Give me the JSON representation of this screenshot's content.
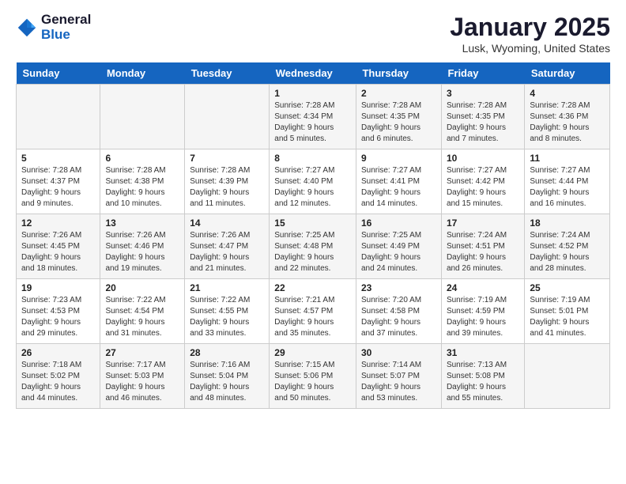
{
  "logo": {
    "general": "General",
    "blue": "Blue"
  },
  "title": "January 2025",
  "location": "Lusk, Wyoming, United States",
  "headers": [
    "Sunday",
    "Monday",
    "Tuesday",
    "Wednesday",
    "Thursday",
    "Friday",
    "Saturday"
  ],
  "weeks": [
    [
      {
        "day": "",
        "content": ""
      },
      {
        "day": "",
        "content": ""
      },
      {
        "day": "",
        "content": ""
      },
      {
        "day": "1",
        "content": "Sunrise: 7:28 AM\nSunset: 4:34 PM\nDaylight: 9 hours\nand 5 minutes."
      },
      {
        "day": "2",
        "content": "Sunrise: 7:28 AM\nSunset: 4:35 PM\nDaylight: 9 hours\nand 6 minutes."
      },
      {
        "day": "3",
        "content": "Sunrise: 7:28 AM\nSunset: 4:35 PM\nDaylight: 9 hours\nand 7 minutes."
      },
      {
        "day": "4",
        "content": "Sunrise: 7:28 AM\nSunset: 4:36 PM\nDaylight: 9 hours\nand 8 minutes."
      }
    ],
    [
      {
        "day": "5",
        "content": "Sunrise: 7:28 AM\nSunset: 4:37 PM\nDaylight: 9 hours\nand 9 minutes."
      },
      {
        "day": "6",
        "content": "Sunrise: 7:28 AM\nSunset: 4:38 PM\nDaylight: 9 hours\nand 10 minutes."
      },
      {
        "day": "7",
        "content": "Sunrise: 7:28 AM\nSunset: 4:39 PM\nDaylight: 9 hours\nand 11 minutes."
      },
      {
        "day": "8",
        "content": "Sunrise: 7:27 AM\nSunset: 4:40 PM\nDaylight: 9 hours\nand 12 minutes."
      },
      {
        "day": "9",
        "content": "Sunrise: 7:27 AM\nSunset: 4:41 PM\nDaylight: 9 hours\nand 14 minutes."
      },
      {
        "day": "10",
        "content": "Sunrise: 7:27 AM\nSunset: 4:42 PM\nDaylight: 9 hours\nand 15 minutes."
      },
      {
        "day": "11",
        "content": "Sunrise: 7:27 AM\nSunset: 4:44 PM\nDaylight: 9 hours\nand 16 minutes."
      }
    ],
    [
      {
        "day": "12",
        "content": "Sunrise: 7:26 AM\nSunset: 4:45 PM\nDaylight: 9 hours\nand 18 minutes."
      },
      {
        "day": "13",
        "content": "Sunrise: 7:26 AM\nSunset: 4:46 PM\nDaylight: 9 hours\nand 19 minutes."
      },
      {
        "day": "14",
        "content": "Sunrise: 7:26 AM\nSunset: 4:47 PM\nDaylight: 9 hours\nand 21 minutes."
      },
      {
        "day": "15",
        "content": "Sunrise: 7:25 AM\nSunset: 4:48 PM\nDaylight: 9 hours\nand 22 minutes."
      },
      {
        "day": "16",
        "content": "Sunrise: 7:25 AM\nSunset: 4:49 PM\nDaylight: 9 hours\nand 24 minutes."
      },
      {
        "day": "17",
        "content": "Sunrise: 7:24 AM\nSunset: 4:51 PM\nDaylight: 9 hours\nand 26 minutes."
      },
      {
        "day": "18",
        "content": "Sunrise: 7:24 AM\nSunset: 4:52 PM\nDaylight: 9 hours\nand 28 minutes."
      }
    ],
    [
      {
        "day": "19",
        "content": "Sunrise: 7:23 AM\nSunset: 4:53 PM\nDaylight: 9 hours\nand 29 minutes."
      },
      {
        "day": "20",
        "content": "Sunrise: 7:22 AM\nSunset: 4:54 PM\nDaylight: 9 hours\nand 31 minutes."
      },
      {
        "day": "21",
        "content": "Sunrise: 7:22 AM\nSunset: 4:55 PM\nDaylight: 9 hours\nand 33 minutes."
      },
      {
        "day": "22",
        "content": "Sunrise: 7:21 AM\nSunset: 4:57 PM\nDaylight: 9 hours\nand 35 minutes."
      },
      {
        "day": "23",
        "content": "Sunrise: 7:20 AM\nSunset: 4:58 PM\nDaylight: 9 hours\nand 37 minutes."
      },
      {
        "day": "24",
        "content": "Sunrise: 7:19 AM\nSunset: 4:59 PM\nDaylight: 9 hours\nand 39 minutes."
      },
      {
        "day": "25",
        "content": "Sunrise: 7:19 AM\nSunset: 5:01 PM\nDaylight: 9 hours\nand 41 minutes."
      }
    ],
    [
      {
        "day": "26",
        "content": "Sunrise: 7:18 AM\nSunset: 5:02 PM\nDaylight: 9 hours\nand 44 minutes."
      },
      {
        "day": "27",
        "content": "Sunrise: 7:17 AM\nSunset: 5:03 PM\nDaylight: 9 hours\nand 46 minutes."
      },
      {
        "day": "28",
        "content": "Sunrise: 7:16 AM\nSunset: 5:04 PM\nDaylight: 9 hours\nand 48 minutes."
      },
      {
        "day": "29",
        "content": "Sunrise: 7:15 AM\nSunset: 5:06 PM\nDaylight: 9 hours\nand 50 minutes."
      },
      {
        "day": "30",
        "content": "Sunrise: 7:14 AM\nSunset: 5:07 PM\nDaylight: 9 hours\nand 53 minutes."
      },
      {
        "day": "31",
        "content": "Sunrise: 7:13 AM\nSunset: 5:08 PM\nDaylight: 9 hours\nand 55 minutes."
      },
      {
        "day": "",
        "content": ""
      }
    ]
  ]
}
